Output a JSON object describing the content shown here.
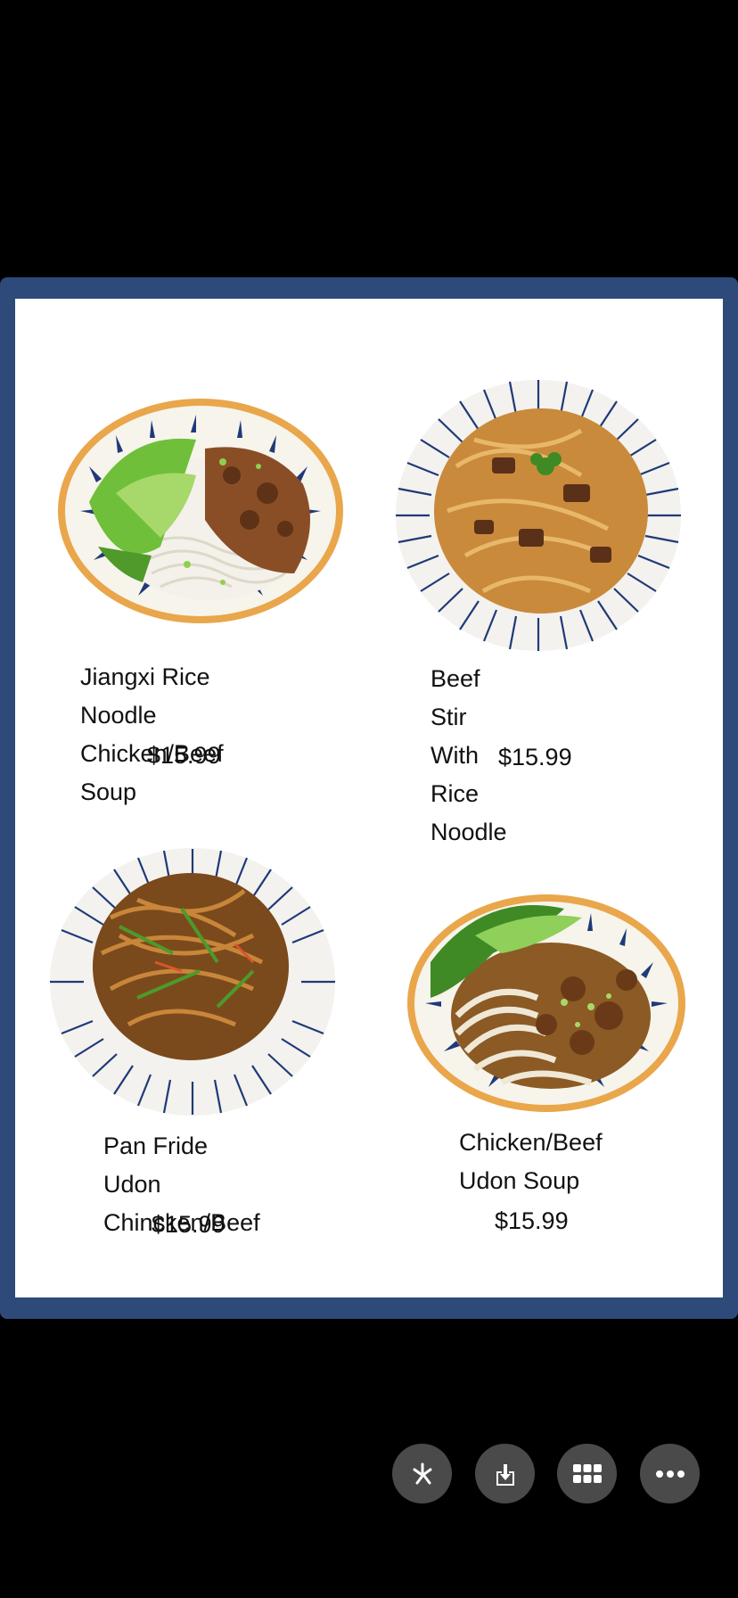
{
  "menu": {
    "items": [
      {
        "name": "Jiangxi Rice Noodle\nChicken/Beef Soup",
        "price": "$15.99",
        "photo_icon": "rice-noodle-soup-bowl"
      },
      {
        "name": "Beef Stir With Rice\nNoodle",
        "price": "$15.99",
        "photo_icon": "beef-stir-fry-bowl"
      },
      {
        "name": "Pan Fride Udon\nChincken/Beef",
        "price": "$15.99",
        "photo_icon": "pan-fried-udon-bowl"
      },
      {
        "name": "Chicken/Beef\nUdon Soup",
        "price": "$15.99",
        "photo_icon": "udon-soup-bowl"
      }
    ]
  },
  "toolbar": {
    "buttons": [
      {
        "icon": "sparkle-icon"
      },
      {
        "icon": "download-icon"
      },
      {
        "icon": "grid-icon"
      },
      {
        "icon": "more-icon"
      }
    ]
  },
  "colors": {
    "frame": "#2e4a7a",
    "background": "#000000",
    "button": "#4a4a4a"
  }
}
